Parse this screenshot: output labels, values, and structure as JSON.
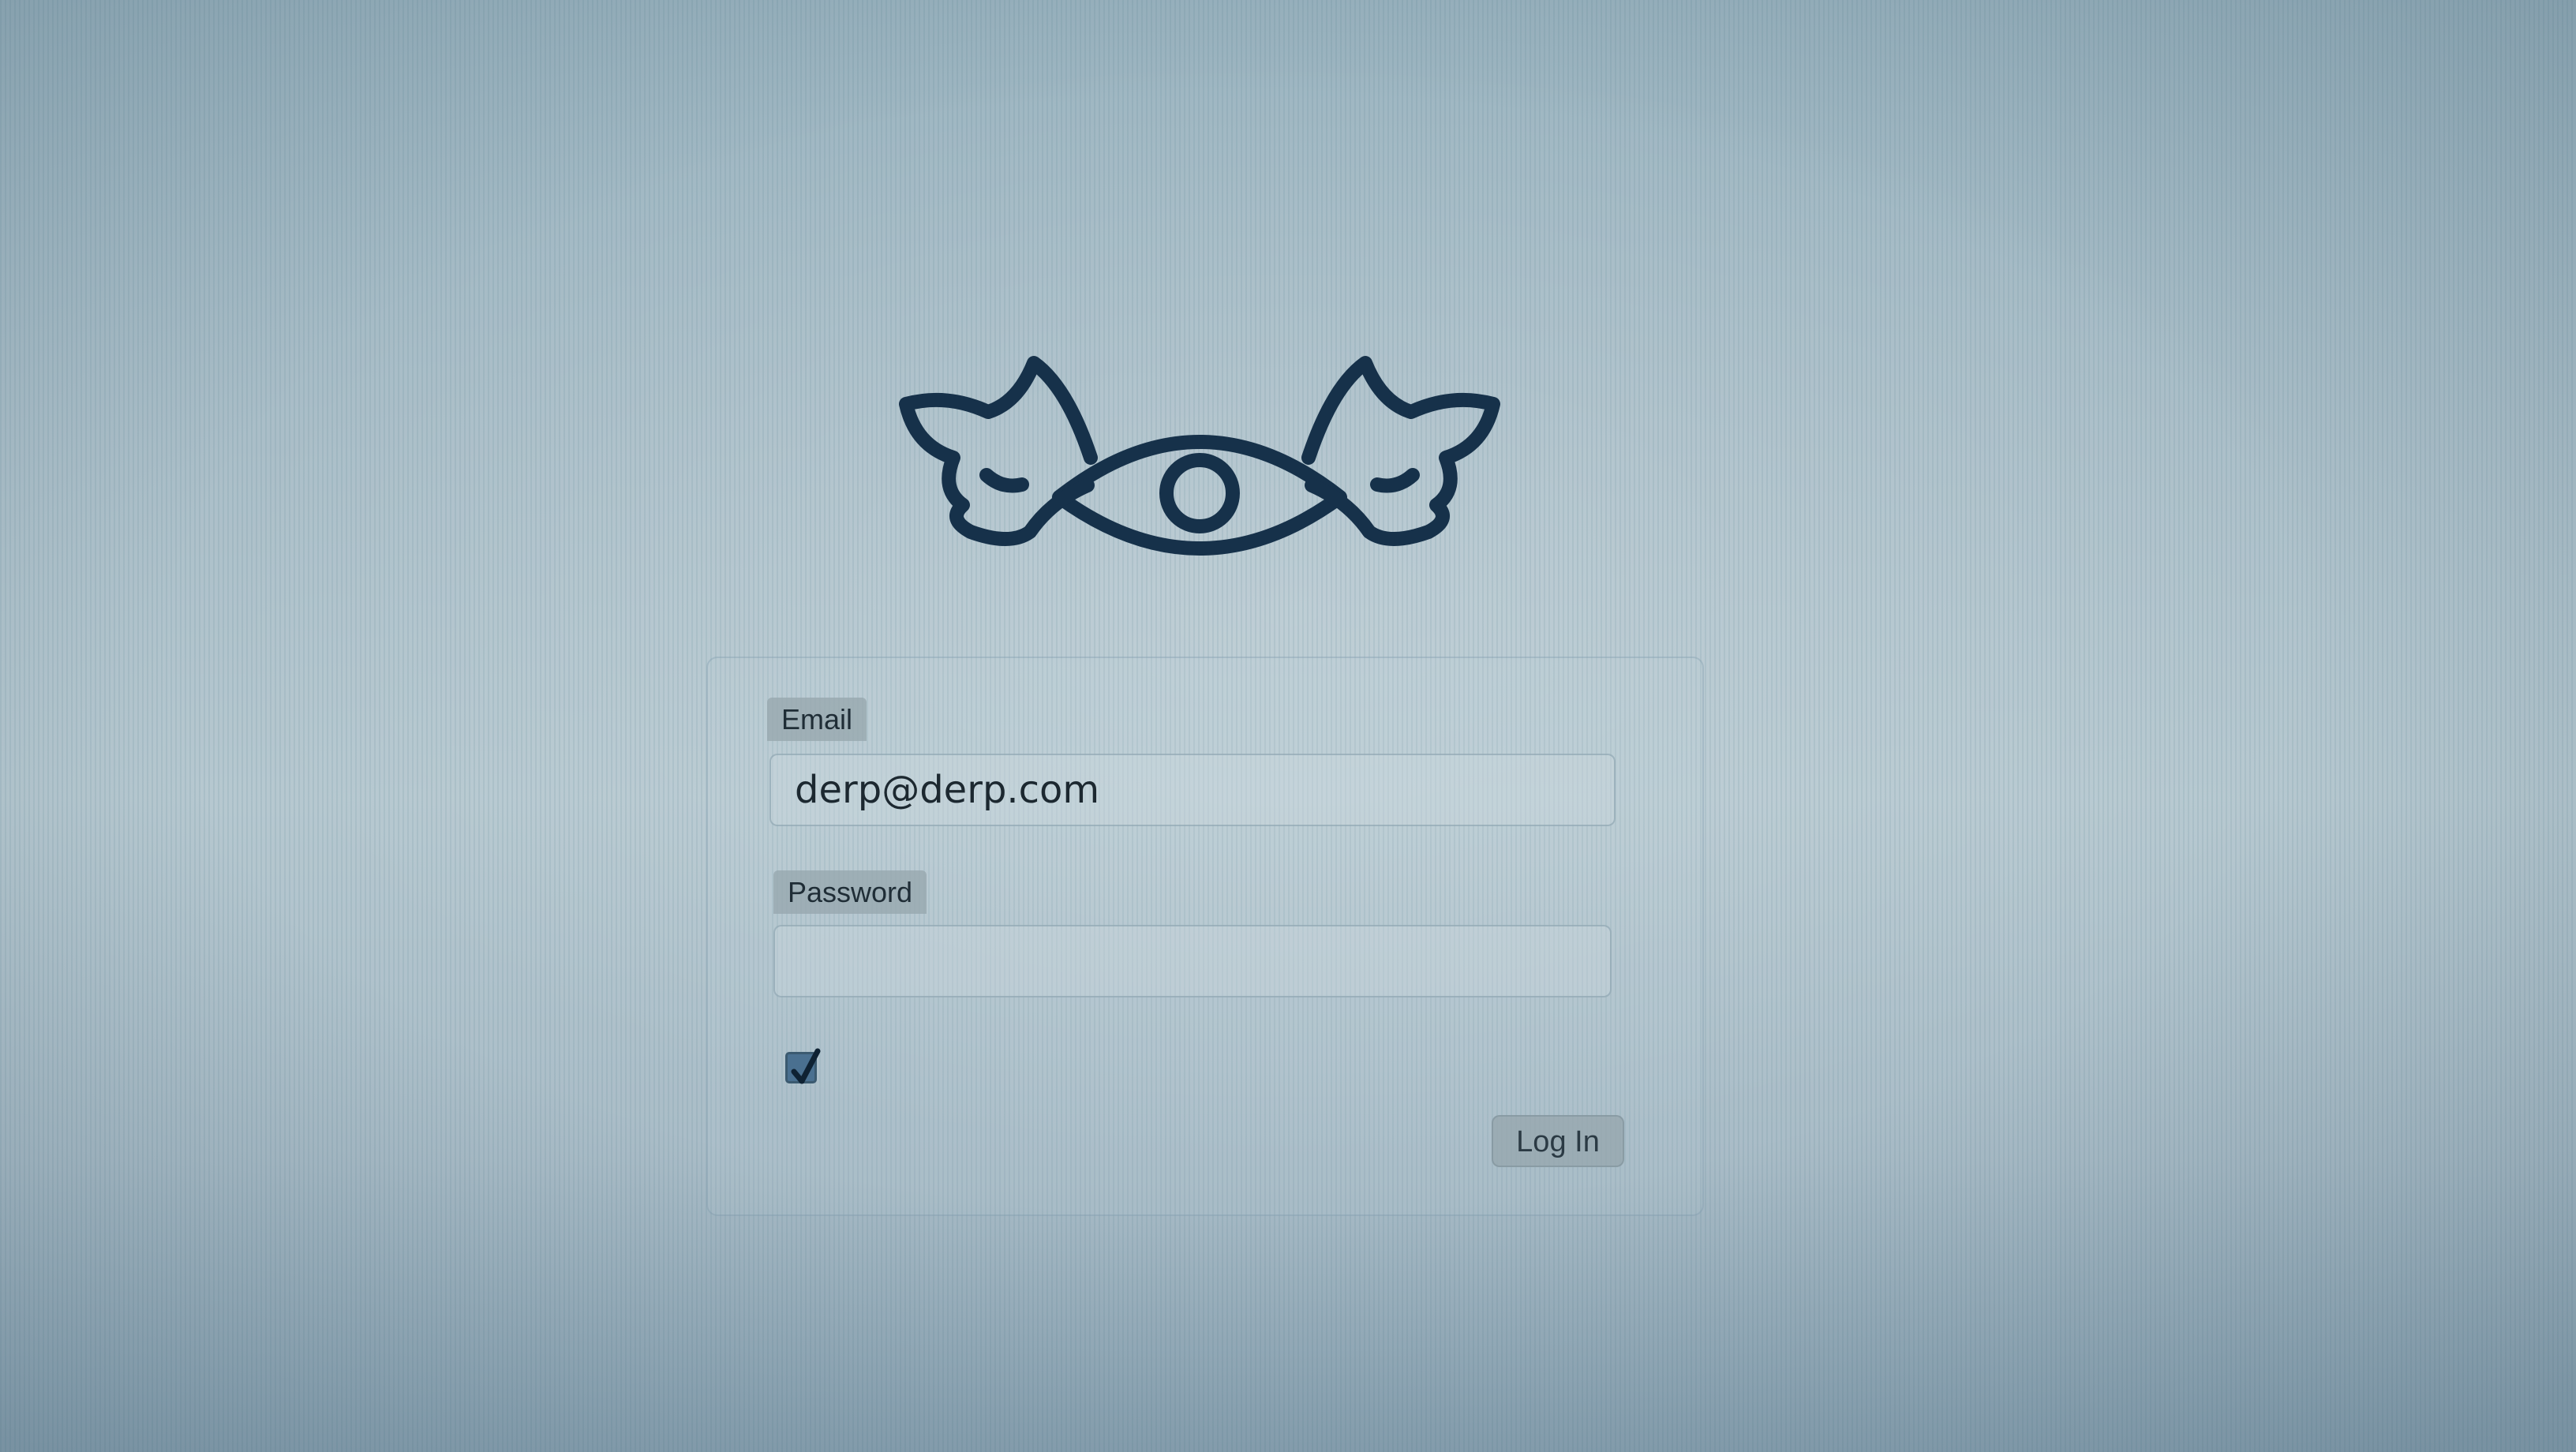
{
  "login_form": {
    "email": {
      "label": "Email",
      "value": "derp@derp.com"
    },
    "password": {
      "label": "Password",
      "value": ""
    },
    "remember_checkbox": {
      "checked": true
    },
    "submit_label": "Log In"
  },
  "logo": {
    "icon": "winged-eye-icon",
    "stroke_color": "#16314a"
  }
}
